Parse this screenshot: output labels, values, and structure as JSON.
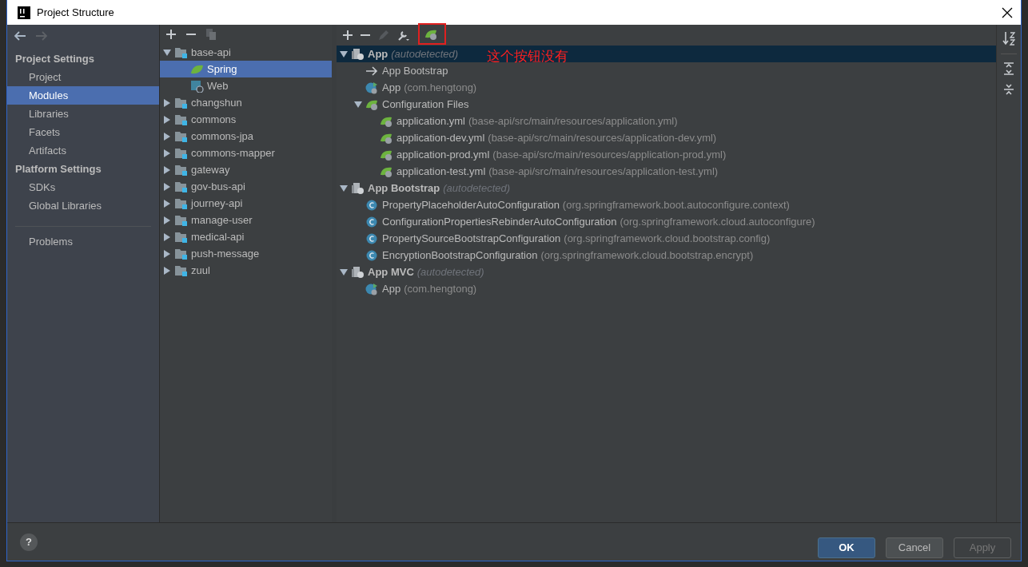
{
  "window": {
    "title": "Project Structure"
  },
  "sections": [
    {
      "heading": "Project Settings",
      "items": [
        {
          "label": "Project",
          "selected": false
        },
        {
          "label": "Modules",
          "selected": true
        },
        {
          "label": "Libraries",
          "selected": false
        },
        {
          "label": "Facets",
          "selected": false
        },
        {
          "label": "Artifacts",
          "selected": false
        }
      ]
    },
    {
      "heading": "Platform Settings",
      "items": [
        {
          "label": "SDKs",
          "selected": false
        },
        {
          "label": "Global Libraries",
          "selected": false
        }
      ]
    },
    {
      "items": [
        {
          "label": "Problems",
          "selected": false
        }
      ]
    }
  ],
  "modules": [
    {
      "kind": "module",
      "name": "base-api",
      "expanded": true,
      "selected": false,
      "children": [
        {
          "kind": "spring",
          "name": "Spring",
          "selected": true
        },
        {
          "kind": "web",
          "name": "Web",
          "selected": false
        }
      ]
    },
    {
      "kind": "module",
      "name": "changshun",
      "expanded": false,
      "selected": false
    },
    {
      "kind": "module",
      "name": "commons",
      "expanded": false,
      "selected": false
    },
    {
      "kind": "module",
      "name": "commons-jpa",
      "expanded": false,
      "selected": false
    },
    {
      "kind": "module",
      "name": "commons-mapper",
      "expanded": false,
      "selected": false
    },
    {
      "kind": "module",
      "name": "gateway",
      "expanded": false,
      "selected": false
    },
    {
      "kind": "module",
      "name": "gov-bus-api",
      "expanded": false,
      "selected": false
    },
    {
      "kind": "module",
      "name": "journey-api",
      "expanded": false,
      "selected": false
    },
    {
      "kind": "module",
      "name": "manage-user",
      "expanded": false,
      "selected": false
    },
    {
      "kind": "module",
      "name": "medical-api",
      "expanded": false,
      "selected": false
    },
    {
      "kind": "module",
      "name": "push-message",
      "expanded": false,
      "selected": false
    },
    {
      "kind": "module",
      "name": "zuul",
      "expanded": false,
      "selected": false
    }
  ],
  "contexts": [
    {
      "kind": "context",
      "name": "App",
      "detail": "(autodetected)",
      "expanded": true,
      "selected": true,
      "children": [
        {
          "kind": "link",
          "name": "App Bootstrap",
          "selected": false
        },
        {
          "kind": "app",
          "name": "App",
          "detail": "(com.hengtong)",
          "selected": false
        },
        {
          "kind": "folder",
          "name": "Configuration Files",
          "expanded": true,
          "selected": false,
          "children": [
            {
              "kind": "config",
              "name": "application.yml",
              "detail": "(base-api/src/main/resources/application.yml)",
              "selected": false
            },
            {
              "kind": "config",
              "name": "application-dev.yml",
              "detail": "(base-api/src/main/resources/application-dev.yml)",
              "selected": false
            },
            {
              "kind": "config",
              "name": "application-prod.yml",
              "detail": "(base-api/src/main/resources/application-prod.yml)",
              "selected": false
            },
            {
              "kind": "config",
              "name": "application-test.yml",
              "detail": "(base-api/src/main/resources/application-test.yml)",
              "selected": false
            }
          ]
        }
      ]
    },
    {
      "kind": "context",
      "name": "App Bootstrap",
      "detail": "(autodetected)",
      "expanded": true,
      "selected": false,
      "children": [
        {
          "kind": "class",
          "name": "PropertyPlaceholderAutoConfiguration",
          "detail": "(org.springframework.boot.autoconfigure.context)",
          "selected": false
        },
        {
          "kind": "class",
          "name": "ConfigurationPropertiesRebinderAutoConfiguration",
          "detail": "(org.springframework.cloud.autoconfigure)",
          "selected": false
        },
        {
          "kind": "class",
          "name": "PropertySourceBootstrapConfiguration",
          "detail": "(org.springframework.cloud.bootstrap.config)",
          "selected": false
        },
        {
          "kind": "class",
          "name": "EncryptionBootstrapConfiguration",
          "detail": "(org.springframework.cloud.bootstrap.encrypt)",
          "selected": false
        }
      ]
    },
    {
      "kind": "context",
      "name": "App MVC",
      "detail": "(autodetected)",
      "expanded": true,
      "selected": false,
      "children": [
        {
          "kind": "app",
          "name": "App",
          "detail": "(com.hengtong)",
          "selected": false
        }
      ]
    }
  ],
  "annotation": {
    "text": "这个按钮没有"
  },
  "footer": {
    "help": "?",
    "buttons": [
      {
        "label": "OK",
        "kind": "default",
        "disabled": false
      },
      {
        "label": "Cancel",
        "kind": "normal",
        "disabled": false
      },
      {
        "label": "Apply",
        "kind": "normal",
        "disabled": true
      }
    ]
  }
}
